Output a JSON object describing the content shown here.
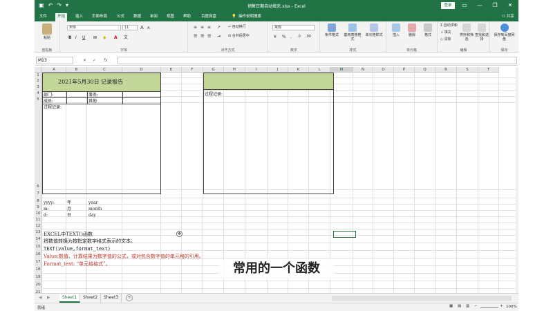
{
  "window": {
    "title": "销售日期自动填充.xlsx - Excel",
    "login_label": "登录",
    "share_label": "共享",
    "help_search": "操作说明搜索",
    "controls": [
      "—",
      "❐",
      "✕"
    ]
  },
  "menu": {
    "tabs": [
      "文件",
      "开始",
      "插入",
      "页面布局",
      "公式",
      "数据",
      "审阅",
      "视图",
      "帮助",
      "百度网盘"
    ],
    "active": "开始"
  },
  "ribbon": {
    "clipboard": {
      "label": "剪贴板",
      "paste": "粘贴"
    },
    "font": {
      "label": "字体",
      "name": "宋体",
      "size": "11",
      "bold": "B",
      "italic": "I",
      "underline": "U",
      "grow": "A",
      "shrink": "A",
      "color_a": "A"
    },
    "alignment": {
      "label": "对齐方式",
      "wrap": "自动换行",
      "merge": "合并后居中"
    },
    "number": {
      "label": "数字",
      "format": "常规",
      "percent": "%",
      "comma": ","
    },
    "styles": {
      "label": "样式",
      "conditional": "条件格式",
      "table": "套用表格格式",
      "cell_styles": "单元格样式"
    },
    "cells": {
      "label": "单元格",
      "insert": "插入",
      "delete": "删除",
      "format": "格式"
    },
    "editing": {
      "label": "编辑",
      "autosum": "自动求和",
      "fill": "填充",
      "clear": "清除",
      "sort": "排序和筛选",
      "find": "查找和选择"
    },
    "save": {
      "label": "保存",
      "baidu": "保存到百度网盘"
    }
  },
  "formula_bar": {
    "name_box": "M13",
    "cancel": "✕",
    "enter": "✓",
    "fx": "fx",
    "value": ""
  },
  "grid": {
    "columns": [
      "A",
      "B",
      "C",
      "D",
      "E",
      "F",
      "G",
      "H",
      "I",
      "J",
      "K",
      "L",
      "M",
      "N",
      "O",
      "P",
      "Q",
      "R",
      "S",
      "T"
    ],
    "selected_column": "M",
    "rows": [
      "1",
      "2",
      "3",
      "4",
      "5",
      "6",
      "7",
      "8",
      "9",
      "10",
      "11",
      "12",
      "13",
      "14",
      "15",
      "16",
      "17",
      "18",
      "19",
      "20",
      "21"
    ],
    "cells": {
      "report_title": "2021年5月30日  记录报告",
      "dept": "部门:",
      "item": "事务:",
      "member": "成员:",
      "other": "其他",
      "process_left": "过程记录:",
      "process_right": "过程记录:",
      "yyyy": "yyyy:",
      "nian": "年",
      "year": "year",
      "m": "m:",
      "yue": "月",
      "month": "month",
      "d": "d:",
      "ri": "日",
      "day": "day",
      "text_func_title": "EXCEL中TEXT()函数",
      "text_func_desc": "将数值转换为按指定数字格式表示的文本。",
      "text_func_syntax": "TEXT(value,format_text)",
      "text_func_value": "Value:数值、计算结果为数字值的公式，或对包含数字值的单元格的引用。",
      "text_func_format": "Format_text: “单元格格式”。"
    }
  },
  "subtitle": "常用的一个函数",
  "sheets": {
    "tabs": [
      "Sheet1",
      "Sheet2",
      "Sheet3"
    ],
    "active": "Sheet1",
    "add": "+"
  },
  "status": {
    "ready": "就绪",
    "zoom": "100%"
  },
  "colors": {
    "excel_green": "#217346",
    "header_fill": "#c4d79b",
    "red_text": "#c0392b"
  }
}
